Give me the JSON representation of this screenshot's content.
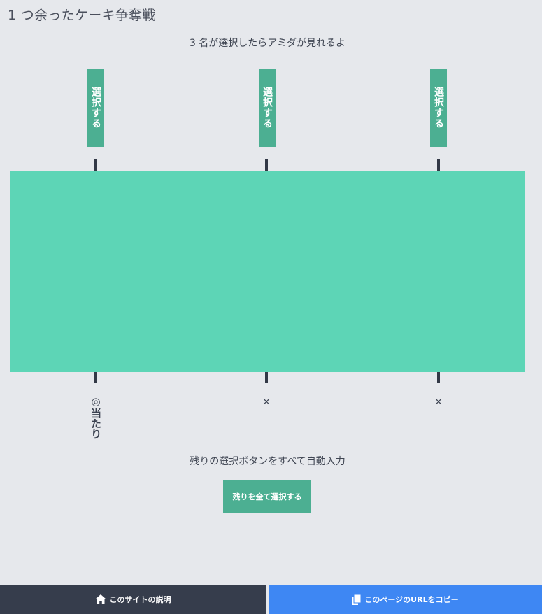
{
  "page": {
    "title": "1 つ余ったケーキ争奪戦",
    "instruction": "3 名が選択したらアミダが見れるよ"
  },
  "columns": [
    {
      "select_label": "選択する",
      "result": "◎当たり"
    },
    {
      "select_label": "選択する",
      "result": "×"
    },
    {
      "select_label": "選択する",
      "result": "×"
    }
  ],
  "auto_fill": {
    "caption": "残りの選択ボタンをすべて自動入力",
    "button_label": "残りを全て選択する"
  },
  "footer": {
    "about_label": "このサイトの説明",
    "about_icon": "home-icon",
    "copy_label": "このページのURLをコピー",
    "copy_icon": "copy-icon"
  },
  "colors": {
    "accent": "#4caf92",
    "board": "#5dd5b6",
    "footer_dark": "#363d4c",
    "footer_blue": "#3e87f3",
    "background": "#e6e8ec"
  }
}
